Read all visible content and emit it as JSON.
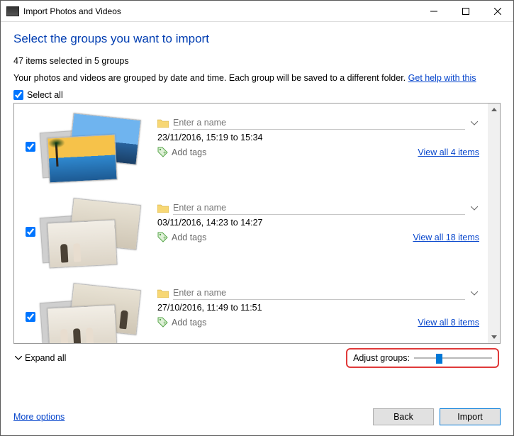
{
  "window": {
    "title": "Import Photos and Videos"
  },
  "header": {
    "page_title": "Select the groups you want to import",
    "summary": "47 items selected in 5 groups",
    "description": "Your photos and videos are grouped by date and time. Each group will be saved to a different folder.",
    "help_link": "Get help with this"
  },
  "select_all": {
    "label": "Select all",
    "checked": true
  },
  "groups": [
    {
      "checked": true,
      "name_placeholder": "Enter a name",
      "date_range": "23/11/2016, 15:19 to 15:34",
      "add_tags": "Add tags",
      "view_all": "View all 4 items"
    },
    {
      "checked": true,
      "name_placeholder": "Enter a name",
      "date_range": "03/11/2016, 14:23 to 14:27",
      "add_tags": "Add tags",
      "view_all": "View all 18 items"
    },
    {
      "checked": true,
      "name_placeholder": "Enter a name",
      "date_range": "27/10/2016, 11:49 to 11:51",
      "add_tags": "Add tags",
      "view_all": "View all 8 items"
    }
  ],
  "below": {
    "expand_all": "Expand all",
    "adjust_label": "Adjust groups:",
    "slider_pos_percent": 28
  },
  "footer": {
    "more_options": "More options",
    "back": "Back",
    "import": "Import"
  }
}
